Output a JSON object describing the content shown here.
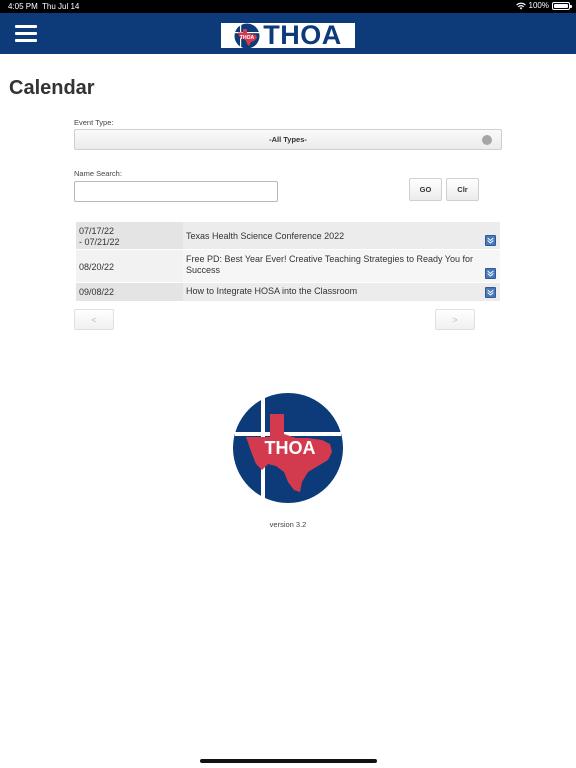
{
  "status_bar": {
    "time": "4:05 PM",
    "date": "Thu Jul 14",
    "battery": "100%",
    "icons": [
      "wifi-icon",
      "battery-icon"
    ]
  },
  "header": {
    "menu_icon": "hamburger-menu-icon",
    "logo_text": "THOA",
    "seal_text": "THOA",
    "background_color": "#0d3a78"
  },
  "page": {
    "title": "Calendar"
  },
  "filters": {
    "event_type_label": "Event Type:",
    "event_type_value": "-All Types-",
    "name_search_label": "Name Search:",
    "name_search_value": "",
    "go_label": "GO",
    "clear_label": "Clr"
  },
  "events": [
    {
      "date_line1": "07/17/22",
      "date_line2": "- 07/21/22",
      "title": "Texas Health Science Conference 2022"
    },
    {
      "date_line1": "08/20/22",
      "date_line2": "",
      "title": "Free PD: Best Year Ever! Creative Teaching Strategies to Ready You for Success"
    },
    {
      "date_line1": "09/08/22",
      "date_line2": "",
      "title": "How to Integrate HOSA into the Classroom"
    }
  ],
  "pagination": {
    "prev_label": "<",
    "next_label": ">"
  },
  "footer": {
    "seal_text": "THOA",
    "version": "version 3.2"
  },
  "colors": {
    "brand_blue": "#0d3a78",
    "brand_red": "#d43a4e",
    "chevron_blue": "#4a78b8"
  }
}
